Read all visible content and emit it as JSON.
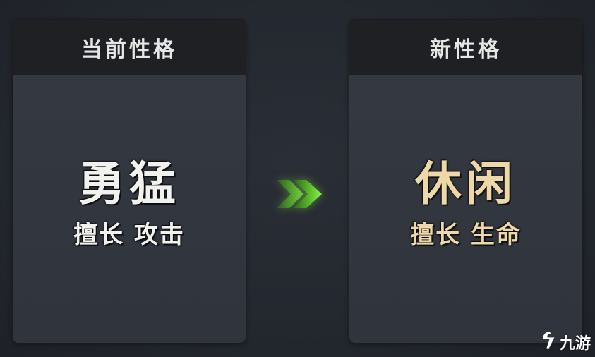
{
  "current": {
    "header": "当前性格",
    "trait": "勇猛",
    "specialty": "擅长 攻击"
  },
  "next": {
    "header": "新性格",
    "trait": "休闲",
    "specialty": "擅长 生命"
  },
  "arrow_icon": "double-chevron-right-icon",
  "colors": {
    "current_text": "#f1f1ee",
    "new_text": "#efd8a8",
    "arrow": "#6fd23a",
    "panel_bg": "#30343d",
    "header_bg": "#1f2024"
  },
  "watermark": {
    "text": "九游",
    "icon": "jiuyou-logo-icon"
  }
}
